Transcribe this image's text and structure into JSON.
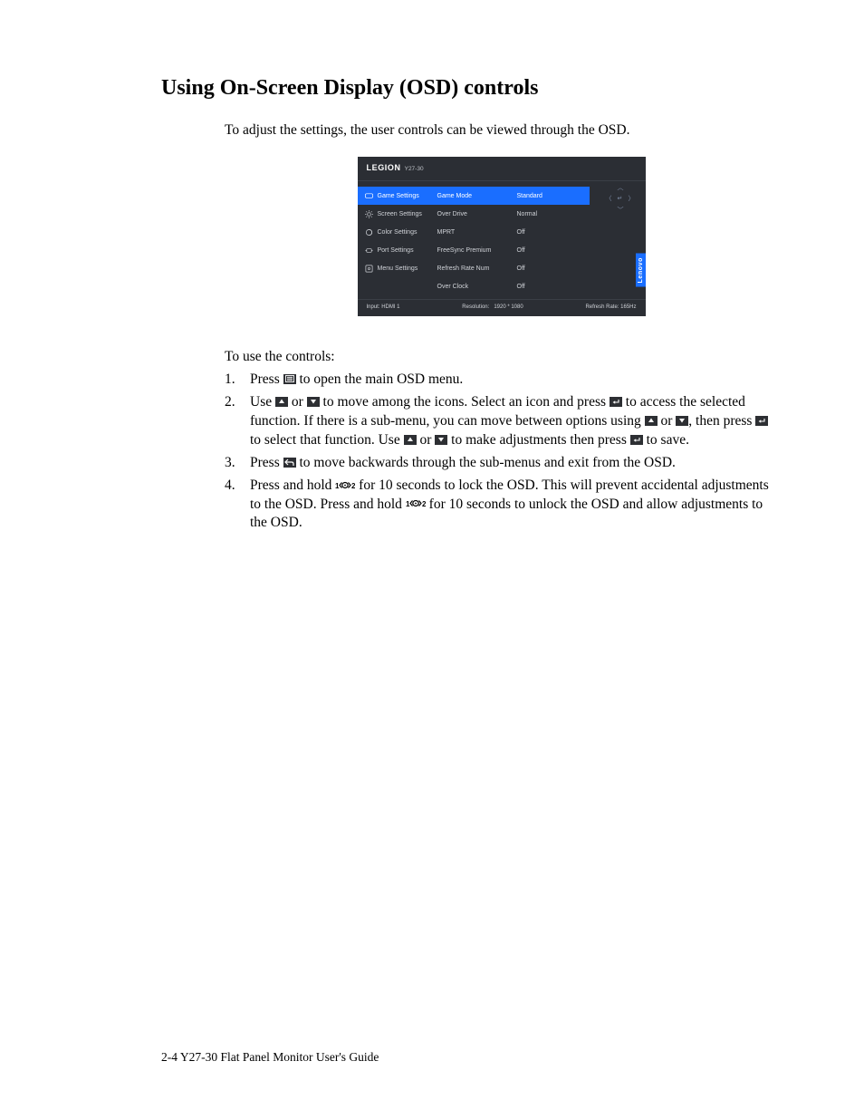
{
  "title": "Using On-Screen Display (OSD) controls",
  "intro": "To adjust the settings, the user controls can be viewed through the OSD.",
  "lead": "To use the controls:",
  "osd": {
    "brand": "LEGION",
    "model": "Y27-30",
    "sidebar": [
      {
        "label": "Game Settings",
        "icon": "game"
      },
      {
        "label": "Screen Settings",
        "icon": "brightness"
      },
      {
        "label": "Color Settings",
        "icon": "color"
      },
      {
        "label": "Port Settings",
        "icon": "port"
      },
      {
        "label": "Menu Settings",
        "icon": "menu"
      }
    ],
    "items": [
      {
        "label": "Game Mode",
        "value": "Standard"
      },
      {
        "label": "Over Drive",
        "value": "Normal"
      },
      {
        "label": "MPRT",
        "value": "Off"
      },
      {
        "label": "FreeSync Premium",
        "value": "Off"
      },
      {
        "label": "Refresh Rate Num",
        "value": "Off"
      },
      {
        "label": "Over Clock",
        "value": "Off"
      }
    ],
    "footer": {
      "input_label": "Input:",
      "input_value": "HDMI 1",
      "resolution_label": "Resolution:",
      "resolution_value": "1920 * 1080",
      "refresh_label": "Refresh Rate:",
      "refresh_value": "165Hz"
    },
    "lenovo": "Lenovo"
  },
  "steps": {
    "s1_a": "Press ",
    "s1_b": " to open the main OSD menu.",
    "s2_a": "Use ",
    "s2_b": " or ",
    "s2_c": " to move among the icons. Select an icon and press ",
    "s2_d": " to access the selected function. If there is a sub-menu, you can move between options using ",
    "s2_e": " or ",
    "s2_f": ", then press ",
    "s2_g": " to select that function. Use ",
    "s2_h": " or ",
    "s2_i": " to make adjustments then press ",
    "s2_j": " to save.",
    "s3_a": "Press ",
    "s3_b": " to move backwards through the sub-menus and exit from the OSD.",
    "s4_a": "Press and hold ",
    "s4_b": " for 10 seconds to lock the OSD. This will prevent accidental adjustments to the OSD. Press and hold ",
    "s4_c": " for 10 seconds to unlock the OSD and allow adjustments to the OSD."
  },
  "nums": {
    "n1": "1.",
    "n2": "2.",
    "n3": "3.",
    "n4": "4."
  },
  "footer": "2-4   Y27-30 Flat Panel Monitor User's Guide"
}
